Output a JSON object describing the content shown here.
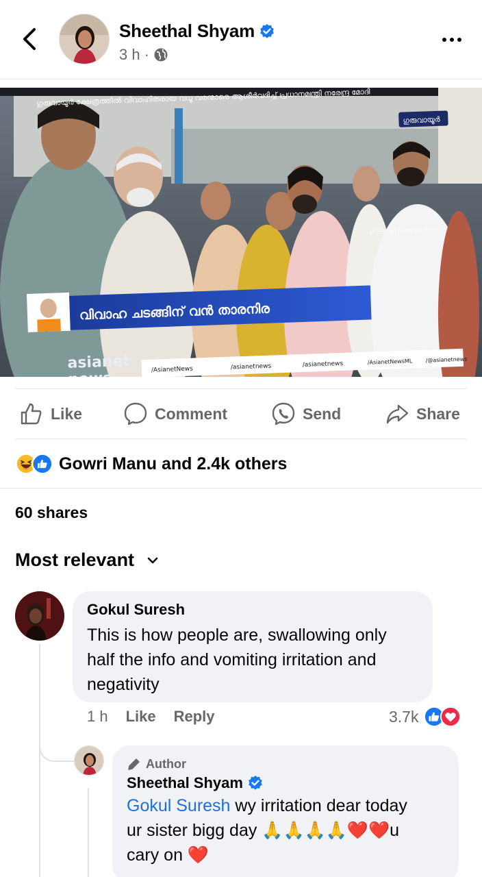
{
  "post": {
    "author": "Sheethal Shyam",
    "time": "3 h",
    "separator": "·"
  },
  "video": {
    "top_caption": "ഗുരുവായൂർ ക്ഷേത്രത്തിൽ വിവാഹിതരായ വധൂ വരന്മാരെ ആശീർവദിച്ച് പ്രധാനമന്ത്രി നരേന്ദ്ര മോദി",
    "location_tag": "ഗുരുവായൂർ",
    "headline": "വിവാഹ ചടങ്ങിന് വൻ താരനിര",
    "channel_logo_top": "asianet",
    "channel_logo_bottom": "news",
    "socials": [
      "/AsianetNews",
      "/asianetnews",
      "/asianetnews",
      "/AsianetNewsML",
      "/@asianetnews"
    ],
    "watermark": "asianetnews.com"
  },
  "actions": {
    "like": "Like",
    "comment": "Comment",
    "send": "Send",
    "share": "Share"
  },
  "reactions": {
    "summary": "Gowri Manu and 2.4k others"
  },
  "shares": "60 shares",
  "sort": {
    "label": "Most relevant"
  },
  "comments": [
    {
      "name": "Gokul Suresh",
      "text": "This is how people are, swallowing only half the info and vomiting irritation and negativity",
      "time": "1 h",
      "like": "Like",
      "reply": "Reply",
      "count": "3.7k"
    }
  ],
  "reply": {
    "badge": "Author",
    "name": "Sheethal Shyam",
    "mention": "Gokul Suresh",
    "text_line1": " wy irritation dear today",
    "text_line2": "ur sister bigg day 🙏🙏🙏🙏❤️❤️u",
    "text_line3": "cary on ❤️"
  },
  "colors": {
    "accent_blue": "#1877f2",
    "muted": "#65676b",
    "bubble": "#f0f2f5",
    "news_blue": "#1f3c96",
    "love_red": "#f02849"
  }
}
